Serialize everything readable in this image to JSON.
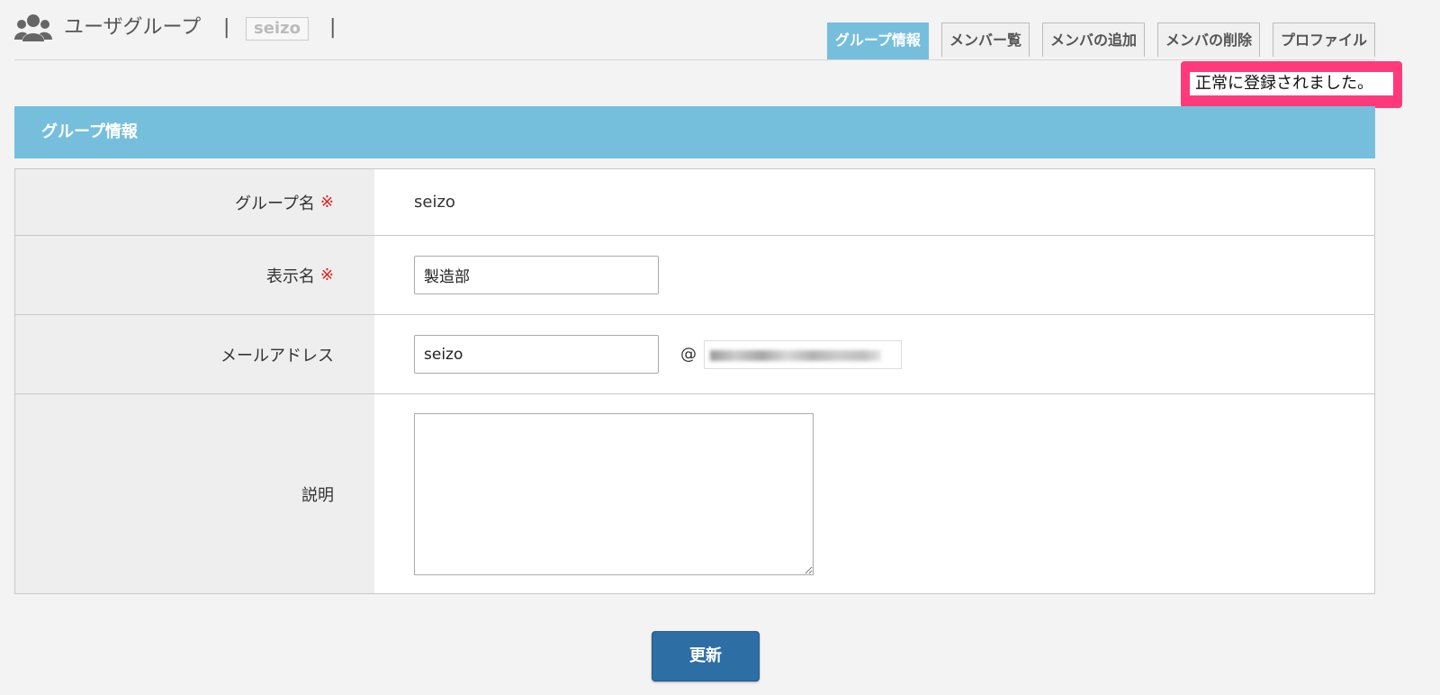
{
  "header": {
    "title": "ユーザグループ",
    "separator": "|",
    "group_chip": "seizo"
  },
  "tabs": [
    {
      "label": "グループ情報",
      "active": true
    },
    {
      "label": "メンバー覧",
      "active": false
    },
    {
      "label": "メンバの追加",
      "active": false
    },
    {
      "label": "メンバの削除",
      "active": false
    },
    {
      "label": "プロファイル",
      "active": false
    }
  ],
  "flash": {
    "message": "正常に登録されました。",
    "border_color": "#ff3a7a"
  },
  "section": {
    "title": "グループ情報",
    "color": "#76bfdc"
  },
  "form": {
    "group_name": {
      "label": "グループ名",
      "required_mark": "※",
      "value": "seizo"
    },
    "display_name": {
      "label": "表示名",
      "required_mark": "※",
      "value": "製造部"
    },
    "email": {
      "label": "メールアドレス",
      "value": "seizo",
      "at": "@"
    },
    "description": {
      "label": "説明",
      "value": ""
    }
  },
  "update_button": {
    "label": "更新",
    "color": "#2d6ea5"
  }
}
